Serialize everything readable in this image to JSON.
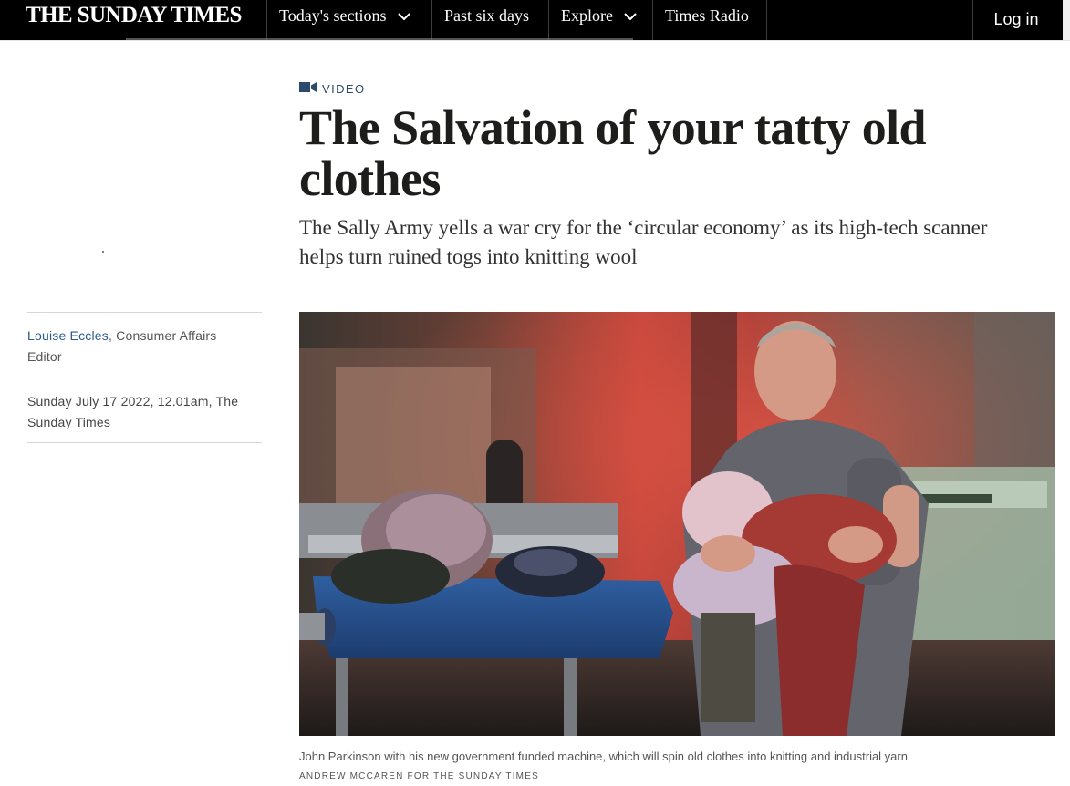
{
  "nav": {
    "masthead": "THE SUNDAY TIMES",
    "items": [
      {
        "label": "Today's sections",
        "has_dropdown": true
      },
      {
        "label": "Past six days",
        "has_dropdown": false
      },
      {
        "label": "Explore",
        "has_dropdown": true
      },
      {
        "label": "Times Radio",
        "has_dropdown": false
      }
    ],
    "login_label": "Log in"
  },
  "article": {
    "kicker": "VIDEO",
    "kicker_icon": "video-camera-icon",
    "headline": "The Salvation of your tatty old clothes",
    "standfirst": "The Sally Army yells a war cry for the ‘circular economy’ as its high-tech scanner helps turn ruined togs into knitting wool",
    "byline": {
      "author": "Louise Eccles",
      "role": ", Consumer Affairs Editor"
    },
    "dateline": "Sunday July 17 2022, 12.01am, The Sunday Times",
    "image": {
      "caption": "John Parkinson with his new government funded machine, which will spin old clothes into knitting and industrial yarn",
      "credit": "ANDREW MCCAREN FOR THE SUNDAY TIMES"
    }
  },
  "colors": {
    "nav_bg": "#000000",
    "kicker": "#2c4a6b",
    "link": "#2c5a8c"
  }
}
